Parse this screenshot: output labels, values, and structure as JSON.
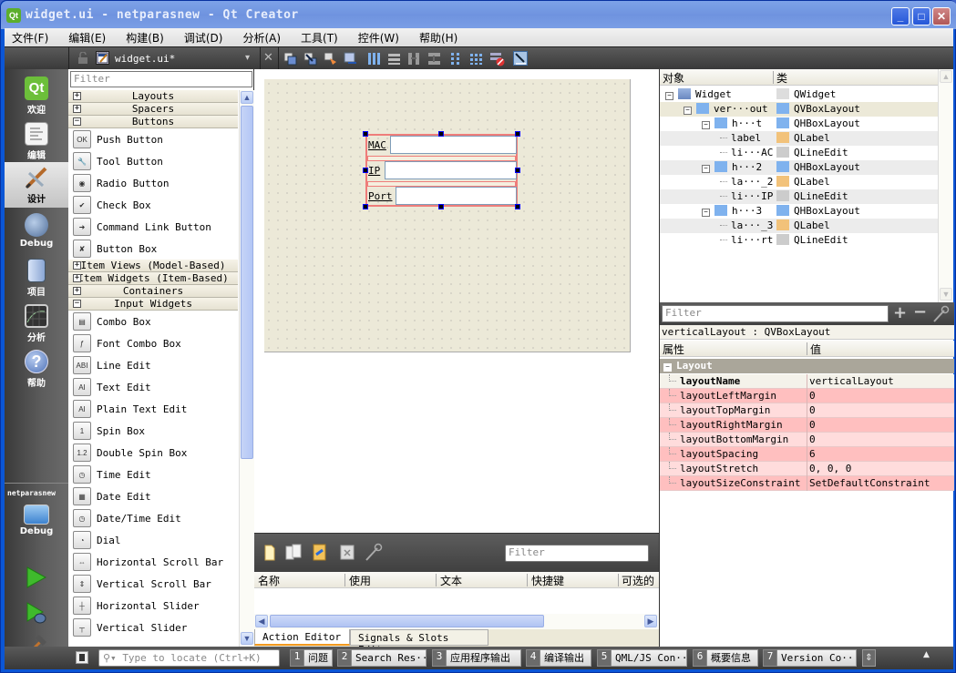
{
  "window": {
    "title": "widget.ui - netparasnew - Qt Creator",
    "minimize": "_",
    "maximize": "□",
    "close": "✕"
  },
  "menu": [
    "文件(F)",
    "编辑(E)",
    "构建(B)",
    "调试(D)",
    "分析(A)",
    "工具(T)",
    "控件(W)",
    "帮助(H)"
  ],
  "editor_toolbar": {
    "file_name": "widget.ui*",
    "close_glyph": "✕",
    "dropdown_glyph": "▾"
  },
  "modes": [
    {
      "label": "欢迎",
      "icon": "qt-logo-icon"
    },
    {
      "label": "编辑",
      "icon": "edit-document-icon"
    },
    {
      "label": "设计",
      "icon": "design-brush-icon",
      "active": true
    },
    {
      "label": "Debug",
      "icon": "bug-icon"
    },
    {
      "label": "项目",
      "icon": "project-folder-icon"
    },
    {
      "label": "分析",
      "icon": "analyze-monitor-icon"
    },
    {
      "label": "帮助",
      "icon": "help-icon"
    }
  ],
  "kit": {
    "project": "netparasnew",
    "build": "Debug"
  },
  "widget_box": {
    "filter_placeholder": "Filter",
    "categories": [
      {
        "label": "Layouts",
        "expanded": false
      },
      {
        "label": "Spacers",
        "expanded": false
      },
      {
        "label": "Buttons",
        "expanded": true,
        "items": [
          "Push Button",
          "Tool Button",
          "Radio Button",
          "Check Box",
          "Command Link Button",
          "Button Box"
        ]
      },
      {
        "label": "Item Views (Model-Based)",
        "expanded": false
      },
      {
        "label": "Item Widgets (Item-Based)",
        "expanded": false
      },
      {
        "label": "Containers",
        "expanded": false
      },
      {
        "label": "Input Widgets",
        "expanded": true,
        "items": [
          "Combo Box",
          "Font Combo Box",
          "Line Edit",
          "Text Edit",
          "Plain Text Edit",
          "Spin Box",
          "Double Spin Box",
          "Time Edit",
          "Date Edit",
          "Date/Time Edit",
          "Dial",
          "Horizontal Scroll Bar",
          "Vertical Scroll Bar",
          "Horizontal Slider",
          "Vertical Slider"
        ]
      }
    ],
    "item_icons": {
      "Push Button": "OK",
      "Tool Button": "🔧",
      "Radio Button": "◉",
      "Check Box": "✔",
      "Command Link Button": "➜",
      "Button Box": "✘",
      "Combo Box": "▤",
      "Font Combo Box": "ƒ",
      "Line Edit": "ABI",
      "Text Edit": "AI",
      "Plain Text Edit": "AI",
      "Spin Box": "1",
      "Double Spin Box": "1.2",
      "Time Edit": "◷",
      "Date Edit": "▦",
      "Date/Time Edit": "◷",
      "Dial": "◔",
      "Horizontal Scroll Bar": "⇔",
      "Vertical Scroll Bar": "⇕",
      "Horizontal Slider": "┼",
      "Vertical Slider": "┬"
    }
  },
  "form": {
    "rows": [
      {
        "label": "MAC",
        "value": ""
      },
      {
        "label": "IP",
        "value": ""
      },
      {
        "label": "Port",
        "value": ""
      }
    ]
  },
  "action_editor": {
    "filter_placeholder": "Filter",
    "columns": [
      "名称",
      "使用",
      "文本",
      "快捷键",
      "可选的"
    ],
    "tabs": [
      "Action Editor",
      "Signals & Slots Editor"
    ],
    "active_tab": 0
  },
  "object_inspector": {
    "columns": [
      "对象",
      "类"
    ],
    "rows": [
      {
        "name": "Widget",
        "class": "QWidget",
        "level": 0,
        "expandable": true,
        "icon": "widget-icon",
        "class_icon": "qwidget-icon"
      },
      {
        "name": "ver···out",
        "class": "QVBoxLayout",
        "level": 1,
        "expandable": true,
        "icon": "vbox-layout-icon",
        "class_icon": "vbox-layout-icon",
        "selected": true
      },
      {
        "name": "h···t",
        "class": "QHBoxLayout",
        "level": 2,
        "expandable": true,
        "icon": "hbox-layout-icon",
        "class_icon": "hbox-layout-icon"
      },
      {
        "name": "label",
        "class": "QLabel",
        "level": 3,
        "icon": "",
        "class_icon": "label-icon"
      },
      {
        "name": "li···AC",
        "class": "QLineEdit",
        "level": 3,
        "icon": "",
        "class_icon": "line-edit-icon"
      },
      {
        "name": "h···2",
        "class": "QHBoxLayout",
        "level": 2,
        "expandable": true,
        "icon": "hbox-layout-icon",
        "class_icon": "hbox-layout-icon"
      },
      {
        "name": "la···_2",
        "class": "QLabel",
        "level": 3,
        "icon": "",
        "class_icon": "label-icon"
      },
      {
        "name": "li···IP",
        "class": "QLineEdit",
        "level": 3,
        "icon": "",
        "class_icon": "line-edit-icon"
      },
      {
        "name": "h···3",
        "class": "QHBoxLayout",
        "level": 2,
        "expandable": true,
        "icon": "hbox-layout-icon",
        "class_icon": "hbox-layout-icon"
      },
      {
        "name": "la···_3",
        "class": "QLabel",
        "level": 3,
        "icon": "",
        "class_icon": "label-icon"
      },
      {
        "name": "li···rt",
        "class": "QLineEdit",
        "level": 3,
        "icon": "",
        "class_icon": "line-edit-icon"
      }
    ]
  },
  "property_editor": {
    "filter_placeholder": "Filter",
    "object_caption": "verticalLayout : QVBoxLayout",
    "columns": [
      "属性",
      "值"
    ],
    "group": "Layout",
    "properties": [
      {
        "name": "layoutName",
        "value": "verticalLayout",
        "bold": true,
        "shade": "none"
      },
      {
        "name": "layoutLeftMargin",
        "value": "0",
        "shade": "dark"
      },
      {
        "name": "layoutTopMargin",
        "value": "0",
        "shade": "light"
      },
      {
        "name": "layoutRightMargin",
        "value": "0",
        "shade": "dark"
      },
      {
        "name": "layoutBottomMargin",
        "value": "0",
        "shade": "light"
      },
      {
        "name": "layoutSpacing",
        "value": "6",
        "shade": "dark"
      },
      {
        "name": "layoutStretch",
        "value": "0, 0, 0",
        "shade": "light"
      },
      {
        "name": "layoutSizeConstraint",
        "value": "SetDefaultConstraint",
        "shade": "dark"
      }
    ]
  },
  "status_bar": {
    "locator_placeholder": "Type to locate (Ctrl+K)",
    "panes": [
      {
        "num": "1",
        "label": "问题"
      },
      {
        "num": "2",
        "label": "Search Res···"
      },
      {
        "num": "3",
        "label": "应用程序输出"
      },
      {
        "num": "4",
        "label": "编译输出"
      },
      {
        "num": "5",
        "label": "QML/JS Con···"
      },
      {
        "num": "6",
        "label": "概要信息"
      },
      {
        "num": "7",
        "label": "Version Co···"
      }
    ]
  },
  "colors": {
    "selection_border": "#ef7d7a",
    "prop_dark": "#ffbfbf",
    "prop_light": "#ffdcdc",
    "canvas_bg": "#ece9d8"
  }
}
